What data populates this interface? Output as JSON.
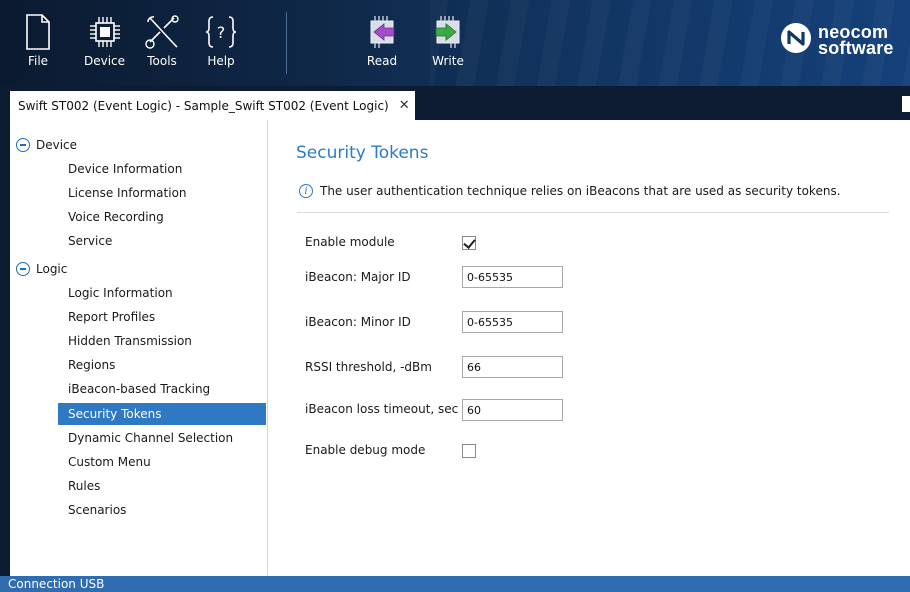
{
  "toolbar": {
    "file_label": "File",
    "device_label": "Device",
    "tools_label": "Tools",
    "help_label": "Help",
    "read_label": "Read",
    "write_label": "Write",
    "logo_line1": "neocom",
    "logo_line2": "software",
    "icons": {
      "file": "file-icon",
      "device": "chip-icon",
      "tools": "tools-icon",
      "help": "help-icon",
      "read": "read-icon",
      "write": "write-icon",
      "logo": "neocom-logo-icon"
    }
  },
  "tab": {
    "title": "Swift ST002 (Event Logic) - Sample_Swift ST002 (Event Logic)",
    "close": "✕"
  },
  "sidebar": {
    "groups": [
      {
        "label": "Device",
        "items": [
          "Device Information",
          "License Information",
          "Voice Recording",
          "Service"
        ]
      },
      {
        "label": "Logic",
        "items": [
          "Logic Information",
          "Report Profiles",
          "Hidden Transmission",
          "Regions",
          "iBeacon-based Tracking",
          "Security Tokens",
          "Dynamic Channel Selection",
          "Custom Menu",
          "Rules",
          "Scenarios"
        ]
      }
    ],
    "selected": "Security Tokens"
  },
  "main": {
    "title": "Security Tokens",
    "info_text": "The user authentication technique relies on iBeacons that are used as security tokens.",
    "fields": {
      "enable_module": {
        "label": "Enable module",
        "checked": true
      },
      "major_id": {
        "label": "iBeacon: Major ID",
        "value": "0-65535"
      },
      "minor_id": {
        "label": "iBeacon: Minor ID",
        "value": "0-65535"
      },
      "rssi": {
        "label": "RSSI threshold, -dBm",
        "value": "66"
      },
      "loss_timeout": {
        "label": "iBeacon loss timeout, sec",
        "value": "60"
      },
      "debug_mode": {
        "label": "Enable debug mode",
        "checked": false
      }
    }
  },
  "status": {
    "text": "Connection USB"
  },
  "colors": {
    "toolbar_bg": "#0f2848",
    "accent": "#2a7bc5",
    "selected_item": "#2f78c4",
    "status_bar": "#2f6db0",
    "read_arrow": "#a24fc7",
    "write_arrow": "#3aa845"
  }
}
